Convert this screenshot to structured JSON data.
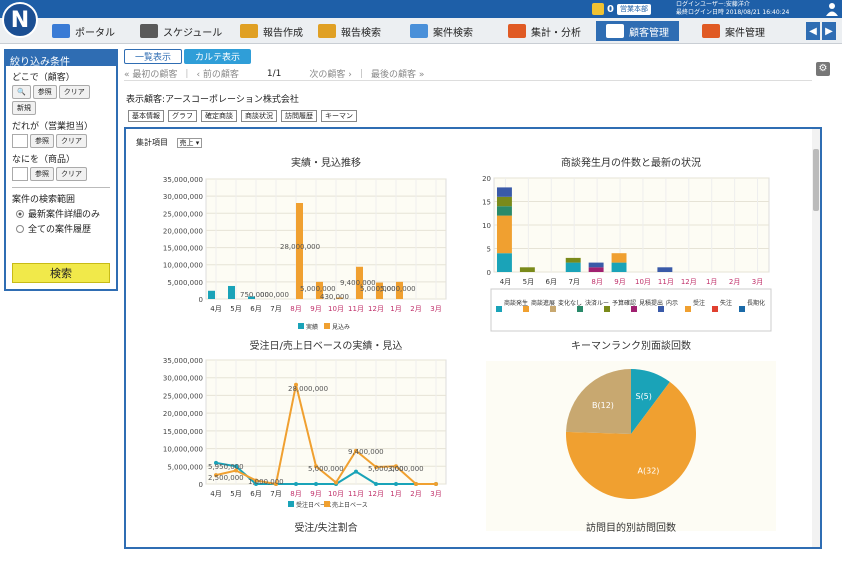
{
  "header": {
    "logo_letter": "N",
    "notification_count": "0",
    "department": "営業本部",
    "user_label": "ログインユーザー:安藤洋介",
    "last_login": "最終ログイン日時 2018/08/21 16:40:24"
  },
  "nav": {
    "items": [
      {
        "label": "ポータル",
        "color": "#3a7bd5"
      },
      {
        "label": "スケジュール",
        "color": "#5a5a5a"
      },
      {
        "label": "報告作成",
        "color": "#e0a024"
      },
      {
        "label": "報告検索",
        "color": "#e0a024"
      },
      {
        "label": "案件検索",
        "color": "#4a90d9"
      },
      {
        "label": "集計・分析",
        "color": "#e05a24"
      },
      {
        "label": "顧客管理",
        "color": "#ffffff"
      },
      {
        "label": "案件管理",
        "color": "#e05a24"
      }
    ],
    "active_index": 6
  },
  "sidebar": {
    "title": "絞り込み条件",
    "where_label": "どこで（顧客）",
    "who_label": "だれが（営業担当）",
    "what_label": "なにを（商品）",
    "ref_button": "参照",
    "clear_button": "クリア",
    "new_button": "新規",
    "scope_label": "案件の検索範囲",
    "scope_options": [
      "最新案件詳細のみ",
      "全ての案件履歴"
    ],
    "search_button": "検索"
  },
  "view_tabs": [
    "一覧表示",
    "カルテ表示"
  ],
  "pager": {
    "first": "最初の顧客",
    "prev": "前の顧客",
    "position": "1/1",
    "next": "次の顧客",
    "last": "最後の顧客"
  },
  "customer_title": "表示顧客:アースコーポレーション株式会社",
  "info_tabs": [
    "基本情報",
    "グラフ",
    "確定商談",
    "商談状況",
    "訪問履歴",
    "キーマン"
  ],
  "aggregate": {
    "label": "集計項目",
    "value": "売上"
  },
  "chart_data": [
    {
      "type": "bar",
      "title": "実績・見込推移",
      "categories": [
        "4月",
        "5月",
        "6月",
        "7月",
        "8月",
        "9月",
        "10月",
        "11月",
        "12月",
        "1月",
        "2月",
        "3月"
      ],
      "series": [
        {
          "name": "実績",
          "color": "#1aa3b8",
          "values": [
            2400000,
            3800000,
            750000,
            0,
            0,
            0,
            0,
            0,
            0,
            0,
            0,
            0
          ]
        },
        {
          "name": "見込み",
          "color": "#f0a030",
          "values": [
            0,
            0,
            0,
            0,
            28000000,
            5000000,
            430000,
            9400000,
            4800000,
            5000000,
            0,
            0
          ]
        }
      ],
      "ylim": [
        0,
        35000000
      ],
      "yticks": [
        "0",
        "5,000,000",
        "10,000,000",
        "15,000,000",
        "20,000,000",
        "25,000,000",
        "30,000,000",
        "35,000,000"
      ],
      "data_labels": [
        "750,000",
        "000,000",
        "28,000,000",
        "5,000,000",
        "430,000",
        "9,400,000",
        "5,000,000",
        "5,000,000"
      ]
    },
    {
      "type": "bar",
      "title": "商談発生月の件数と最新の状況",
      "categories": [
        "4月",
        "5月",
        "6月",
        "7月",
        "8月",
        "9月",
        "10月",
        "11月",
        "12月",
        "1月",
        "2月",
        "3月"
      ],
      "series": [
        {
          "name": "商談発生",
          "color": "#1aa3b8",
          "values": [
            4,
            0,
            0,
            2,
            0,
            2,
            0,
            0,
            0,
            0,
            0,
            0
          ]
        },
        {
          "name": "商談進展",
          "color": "#f0a030",
          "values": [
            8,
            0,
            0,
            0,
            0,
            2,
            0,
            0,
            0,
            0,
            0,
            0
          ]
        },
        {
          "name": "変化なし",
          "color": "#c8a870",
          "values": [
            0,
            0,
            0,
            0,
            0,
            0,
            0,
            0,
            0,
            0,
            0,
            0
          ]
        },
        {
          "name": "決済ルート確認",
          "color": "#2a8a6a",
          "values": [
            2,
            0,
            0,
            0,
            0,
            0,
            0,
            0,
            0,
            0,
            0,
            0
          ]
        },
        {
          "name": "予算確認",
          "color": "#7a8a1a",
          "values": [
            2,
            1,
            0,
            1,
            0,
            0,
            0,
            0,
            0,
            0,
            0,
            0
          ]
        },
        {
          "name": "見積提出",
          "color": "#a02070",
          "values": [
            0,
            0,
            0,
            0,
            1,
            0,
            0,
            0,
            0,
            0,
            0,
            0
          ]
        },
        {
          "name": "内示",
          "color": "#3a5aa8",
          "values": [
            2,
            0,
            0,
            0,
            1,
            0,
            0,
            1,
            0,
            0,
            0,
            0
          ]
        }
      ],
      "legend_extra": [
        "受注",
        "失注",
        "長期化"
      ],
      "ylim": [
        0,
        20
      ],
      "yticks": [
        "0",
        "5",
        "10",
        "15",
        "20"
      ]
    },
    {
      "type": "line",
      "title": "受注日/売上日ベースの実績・見込",
      "categories": [
        "4月",
        "5月",
        "6月",
        "7月",
        "8月",
        "9月",
        "10月",
        "11月",
        "12月",
        "1月",
        "2月",
        "3月"
      ],
      "series": [
        {
          "name": "受注日ベース",
          "color": "#1aa3b8",
          "values": [
            5950000,
            5000000,
            0,
            0,
            0,
            0,
            0,
            3500000,
            0,
            0,
            0,
            0
          ]
        },
        {
          "name": "売上日ベース",
          "color": "#f0a030",
          "values": [
            2500000,
            3800000,
            1000000,
            0,
            28000000,
            5000000,
            430000,
            9400000,
            4800000,
            5000000,
            0,
            0
          ]
        }
      ],
      "ylim": [
        0,
        35000000
      ],
      "yticks": [
        "0",
        "5,000,000",
        "10,000,000",
        "15,000,000",
        "20,000,000",
        "25,000,000",
        "30,000,000",
        "35,000,000"
      ],
      "data_labels": [
        "5,950,000",
        "2,500,000",
        "1,000,000",
        "28,000,000",
        "5,000,000",
        "9,400,000",
        "5,000,000",
        "3,000,000"
      ]
    },
    {
      "type": "pie",
      "title": "キーマンランク別面談回数",
      "slices": [
        {
          "label": "S(5)",
          "value": 5,
          "color": "#1aa3b8"
        },
        {
          "label": "A(32)",
          "value": 32,
          "color": "#f0a030"
        },
        {
          "label": "B(12)",
          "value": 12,
          "color": "#c8a870"
        }
      ]
    }
  ],
  "lower_titles": [
    "受注/失注割合",
    "訪問目的別訪問回数"
  ]
}
